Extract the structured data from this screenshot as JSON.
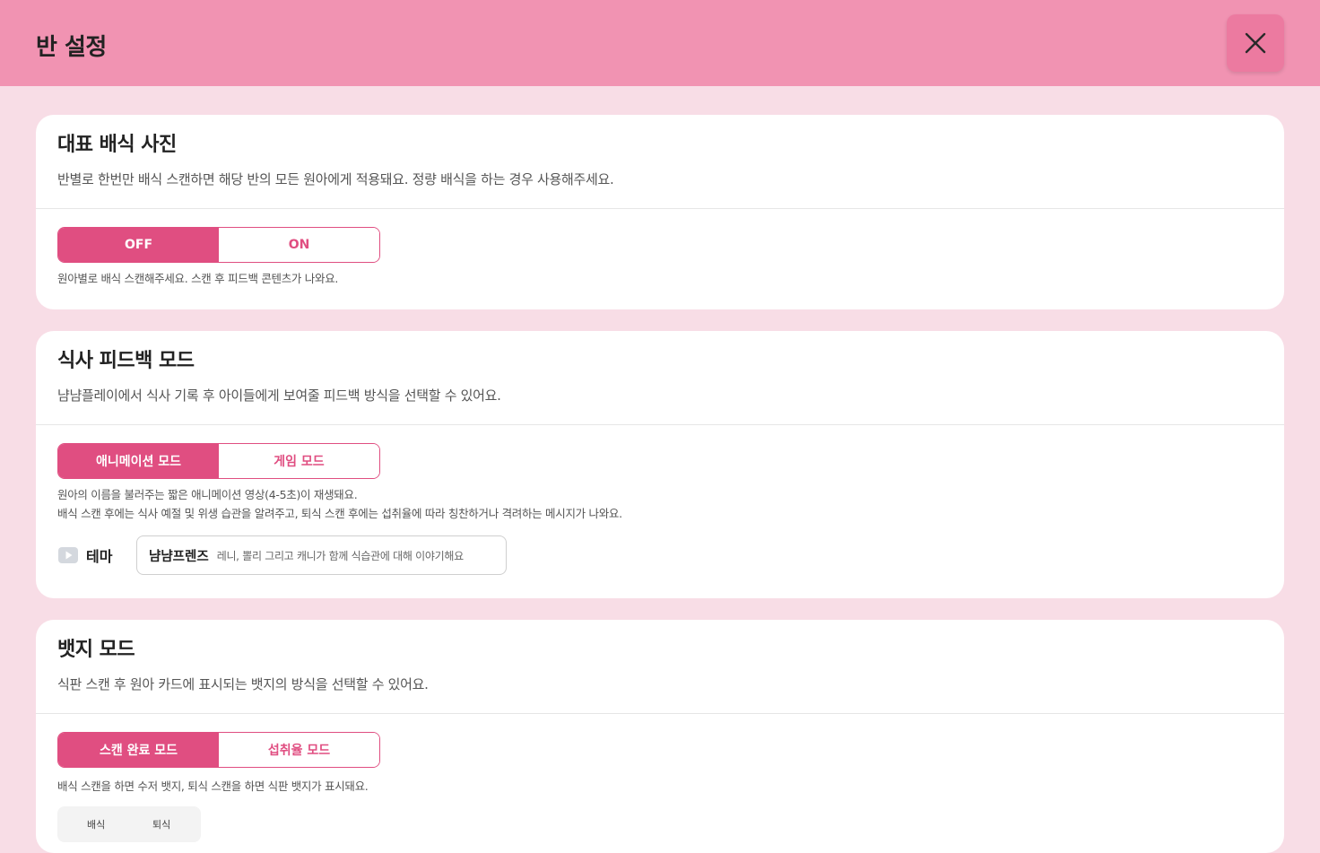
{
  "header": {
    "title": "반 설정",
    "close_icon": "close-icon"
  },
  "cards": [
    {
      "title": "대표 배식 사진",
      "description": "반별로 한번만 배식 스캔하면 해당 반의 모든 원아에게 적용돼요. 정량 배식을 하는 경우 사용해주세요.",
      "options": [
        "OFF",
        "ON"
      ],
      "selected": "OFF",
      "notes": [
        "원아별로 배식 스캔해주세요. 스캔 후 피드백 콘텐츠가 나와요."
      ]
    },
    {
      "title": "식사 피드백 모드",
      "description": "냠냠플레이에서 식사 기록 후 아이들에게 보여줄 피드백 방식을 선택할 수 있어요.",
      "options": [
        "애니메이션 모드",
        "게임 모드"
      ],
      "selected": "애니메이션 모드",
      "notes": [
        "원아의 이름을 불러주는 짧은 애니메이션 영상(4-5초)이 재생돼요.",
        "배식 스캔 후에는 식사 예절 및 위생 습관을 알려주고, 퇴식 스캔 후에는 섭취율에 따라 칭찬하거나 격려하는 메시지가 나와요."
      ],
      "theme": {
        "label": "테마",
        "icon": "video-play-icon",
        "value": "냠냠프렌즈",
        "value_desc": "레니, 뽈리 그리고 캐니가 함께 식습관에 대해 이야기해요"
      }
    },
    {
      "title": "뱃지 모드",
      "description": "식판 스캔 후 원아 카드에 표시되는 뱃지의 방식을 선택할 수 있어요.",
      "options": [
        "스캔 완료 모드",
        "섭취율 모드"
      ],
      "selected": "스캔 완료 모드",
      "notes": [
        "배식 스캔을 하면 수저 뱃지, 퇴식 스캔을 하면 식판 뱃지가 표시돼요."
      ],
      "preview_labels": [
        "배식",
        "퇴식"
      ]
    }
  ],
  "colors": {
    "header_bg": "#f193b2",
    "page_bg": "#f8dde6",
    "accent": "#e04e81",
    "close_btn_bg": "#ec7aa0"
  }
}
